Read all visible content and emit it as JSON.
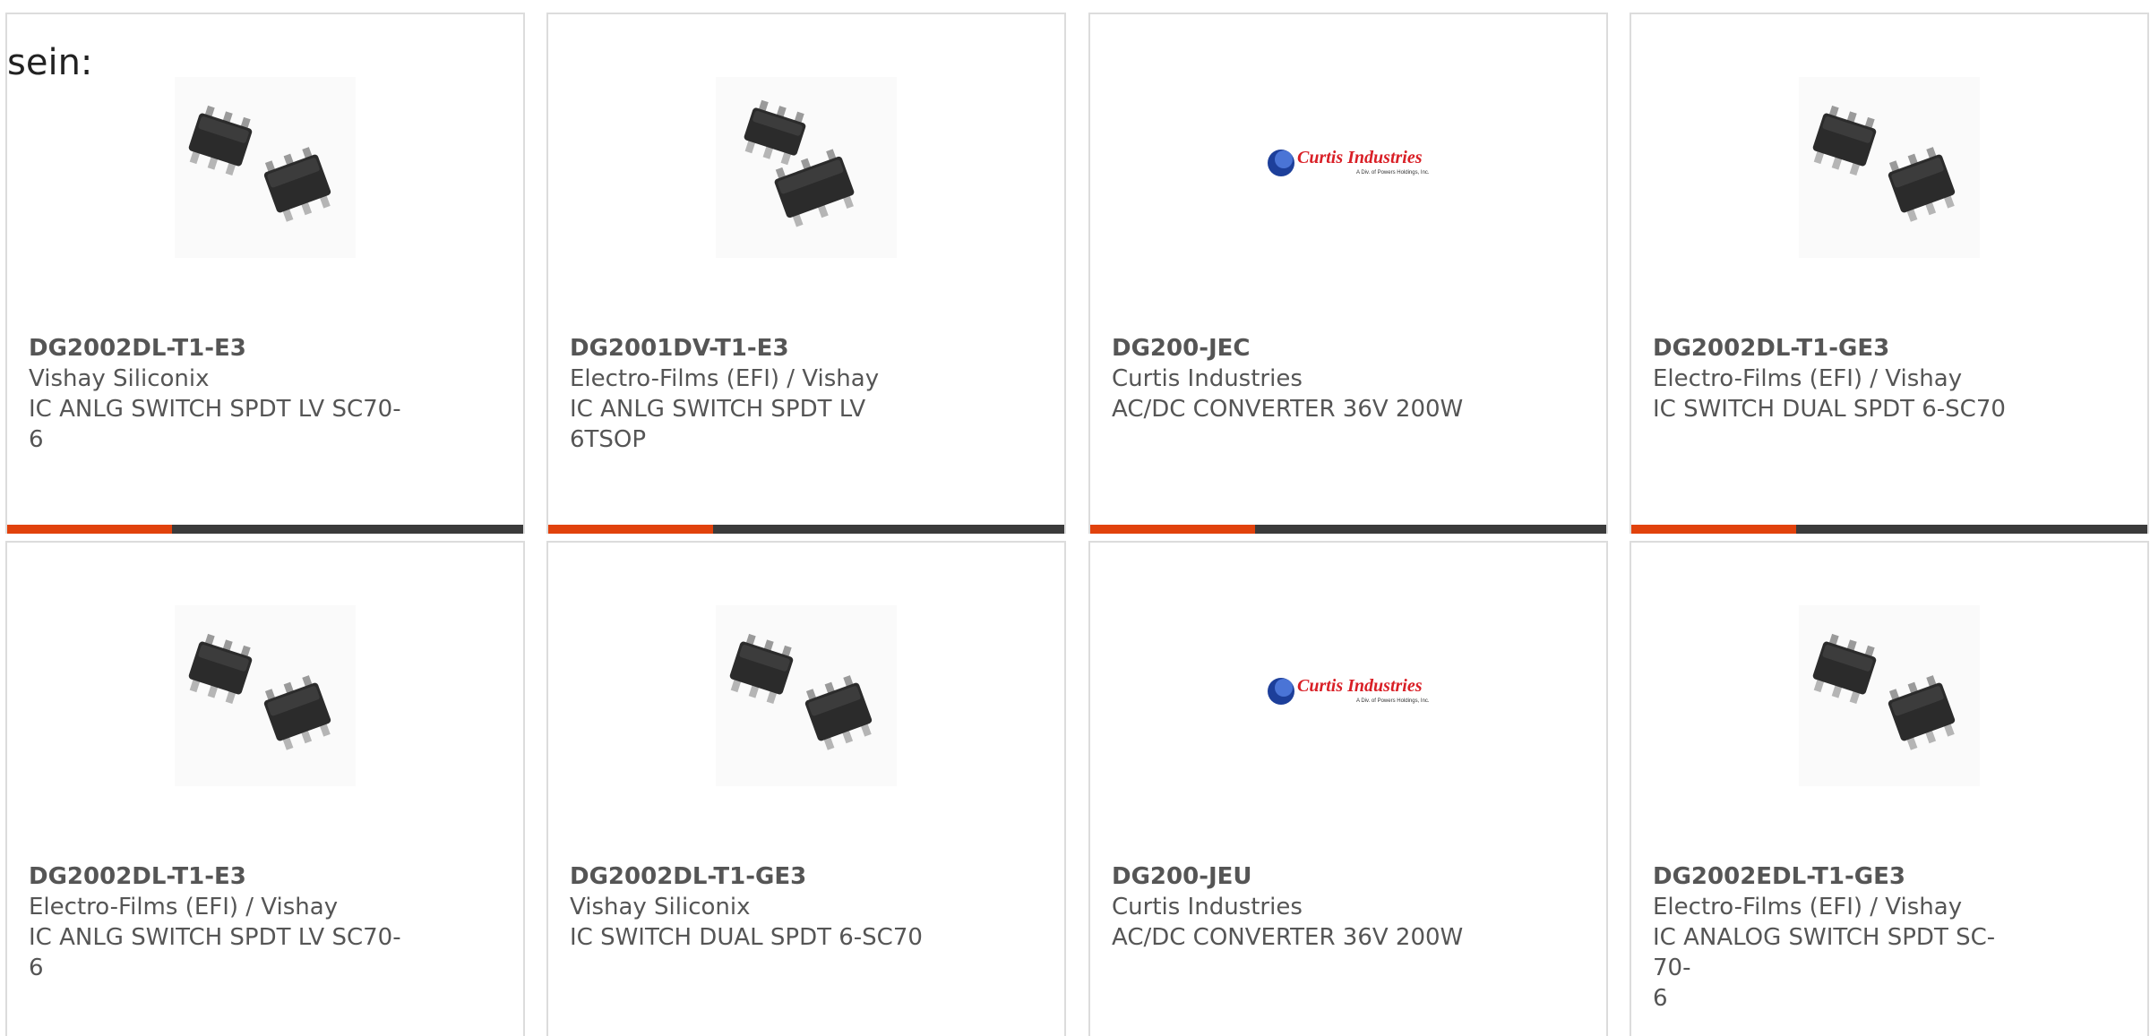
{
  "intro_text": "sein:",
  "colors": {
    "accent": "#e1420c",
    "bar": "#3b3b3b",
    "text": "#555555",
    "card_border": "#dcdcdc"
  },
  "logo": {
    "text": "Curtis Industries",
    "subtext": "A Div. of Powers Holdings, Inc."
  },
  "cards": [
    {
      "part": "DG2002DL-T1-E3",
      "maker": "Vishay Siliconix",
      "desc": "IC ANLG SWITCH SPDT LV SC70-\n6",
      "image": "sc70-chip-pair"
    },
    {
      "part": "DG2001DV-T1-E3",
      "maker": "Electro-Films (EFI) / Vishay",
      "desc": "IC ANLG SWITCH SPDT LV\n6TSOP",
      "image": "tsop-chip-pair"
    },
    {
      "part": "DG200-JEC",
      "maker": "Curtis Industries",
      "desc": "AC/DC CONVERTER 36V 200W",
      "image": "curtis-logo"
    },
    {
      "part": "DG2002DL-T1-GE3",
      "maker": "Electro-Films (EFI) / Vishay",
      "desc": "IC SWITCH DUAL SPDT 6-SC70",
      "image": "sc70-chip-pair"
    },
    {
      "part": "DG2002DL-T1-E3",
      "maker": "Electro-Films (EFI) / Vishay",
      "desc": "IC ANLG SWITCH SPDT LV SC70-\n6",
      "image": "sc70-chip-pair"
    },
    {
      "part": "DG2002DL-T1-GE3",
      "maker": "Vishay Siliconix",
      "desc": "IC SWITCH DUAL SPDT 6-SC70",
      "image": "sc70-chip-pair"
    },
    {
      "part": "DG200-JEU",
      "maker": "Curtis Industries",
      "desc": "AC/DC CONVERTER 36V 200W",
      "image": "curtis-logo"
    },
    {
      "part": "DG2002EDL-T1-GE3",
      "maker": "Electro-Films (EFI) / Vishay",
      "desc": "IC ANALOG SWITCH SPDT SC-70-\n6",
      "image": "sc70-chip-pair"
    }
  ]
}
